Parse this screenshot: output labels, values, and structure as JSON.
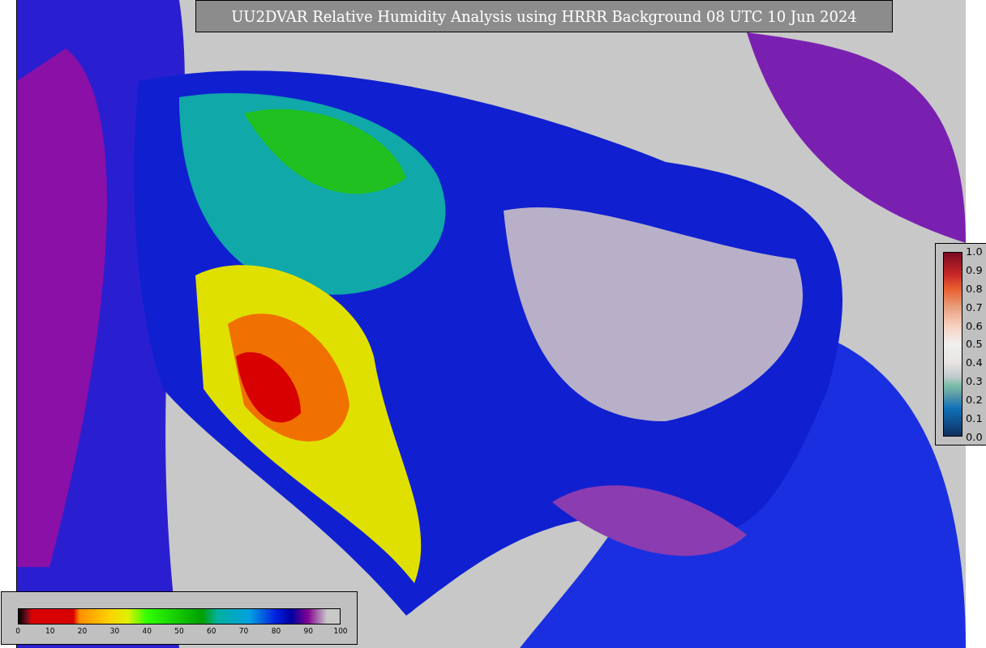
{
  "title": "UU2DVAR Relative Humidity Analysis using HRRR Background 08 UTC 10 Jun 2024",
  "humidity_colorbar": {
    "ticks": [
      "0",
      "10",
      "20",
      "30",
      "40",
      "50",
      "60",
      "70",
      "80",
      "90",
      "100"
    ]
  },
  "ratio_colorbar": {
    "ticks": [
      "1.0",
      "0.9",
      "0.8",
      "0.7",
      "0.6",
      "0.5",
      "0.4",
      "0.3",
      "0.2",
      "0.1",
      "0.0"
    ]
  }
}
